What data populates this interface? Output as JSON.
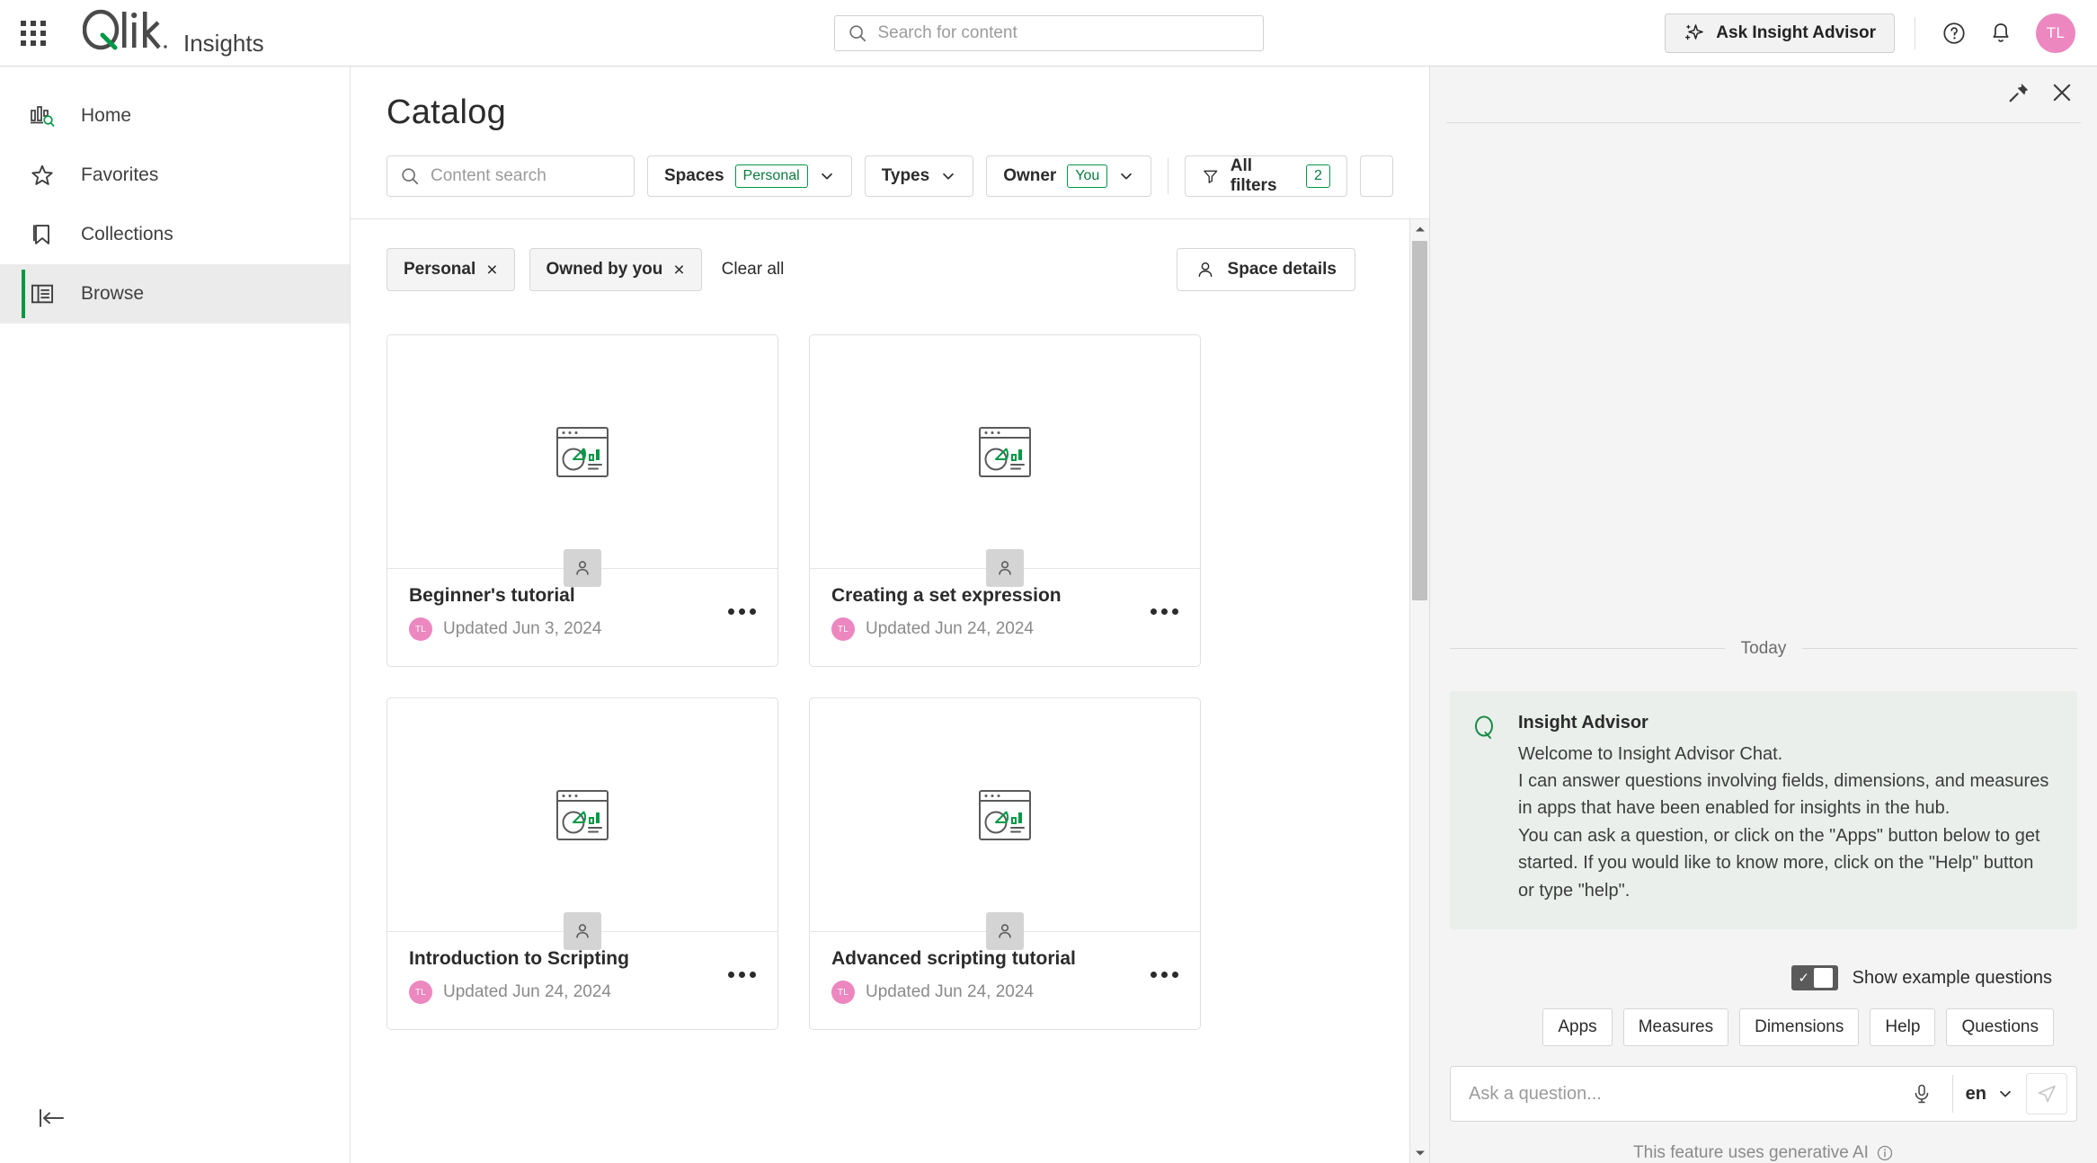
{
  "header": {
    "brand": "Qlik",
    "product": "Insights",
    "search": {
      "placeholder": "Search for content",
      "value": ""
    },
    "ask_advisor_label": "Ask Insight Advisor",
    "avatar_initials": "TL",
    "icons": {
      "launcher": "grid-launcher-icon",
      "search": "search-icon",
      "sparkle": "sparkle-icon",
      "help": "help-circle-icon",
      "bell": "notification-bell-icon"
    }
  },
  "sidebar": {
    "items": [
      {
        "label": "Home",
        "icon": "home-insights-icon",
        "active": false
      },
      {
        "label": "Favorites",
        "icon": "star-icon",
        "active": false
      },
      {
        "label": "Collections",
        "icon": "bookmark-icon",
        "active": false
      },
      {
        "label": "Browse",
        "icon": "browse-icon",
        "active": true
      }
    ],
    "collapse_icon": "collapse-sidebar-icon"
  },
  "main": {
    "title": "Catalog",
    "content_search": {
      "placeholder": "Content search",
      "value": ""
    },
    "filters": [
      {
        "label": "Spaces",
        "badge": "Personal",
        "has_caret": true
      },
      {
        "label": "Types",
        "badge": "",
        "has_caret": true
      },
      {
        "label": "Owner",
        "badge": "You",
        "has_caret": true
      }
    ],
    "all_filters": {
      "label": "All filters",
      "count": "2",
      "icon": "funnel-icon"
    },
    "chips": [
      {
        "label": "Personal",
        "close": "×"
      },
      {
        "label": "Owned by you",
        "close": "×"
      }
    ],
    "clear_all_label": "Clear all",
    "space_details_label": "Space details",
    "cards": [
      {
        "title": "Beginner's tutorial",
        "updated": "Updated Jun 3, 2024",
        "owner_initials": "TL"
      },
      {
        "title": "Creating a set expression",
        "updated": "Updated Jun 24, 2024",
        "owner_initials": "TL"
      },
      {
        "title": "Introduction to Scripting",
        "updated": "Updated Jun 24, 2024",
        "owner_initials": "TL"
      },
      {
        "title": "Advanced scripting tutorial",
        "updated": "Updated Jun 24, 2024",
        "owner_initials": "TL"
      }
    ]
  },
  "chat": {
    "pin_icon": "pin-icon",
    "close_icon": "close-icon",
    "date_separator": "Today",
    "message": {
      "author": "Insight Advisor",
      "line1": "Welcome to Insight Advisor Chat.",
      "line2": "I can answer questions involving fields, dimensions, and measures in apps that have been enabled for insights in the hub.",
      "line3": "You can ask a question, or click on the \"Apps\" button below to get started. If you would like to know more, click on the \"Help\" button or type \"help\"."
    },
    "toggle": {
      "label": "Show example questions",
      "on": true
    },
    "quick_buttons": [
      "Apps",
      "Measures",
      "Dimensions",
      "Help",
      "Questions"
    ],
    "composer": {
      "placeholder": "Ask a question...",
      "value": "",
      "language": "en",
      "mic_icon": "microphone-icon",
      "send_icon": "send-icon"
    },
    "footer_note": "This feature uses generative AI"
  },
  "colors": {
    "green": "#009845",
    "avatar_pink": "#ec87c0",
    "panel_bg": "#f4f4f4",
    "message_bg": "#eaefec"
  }
}
